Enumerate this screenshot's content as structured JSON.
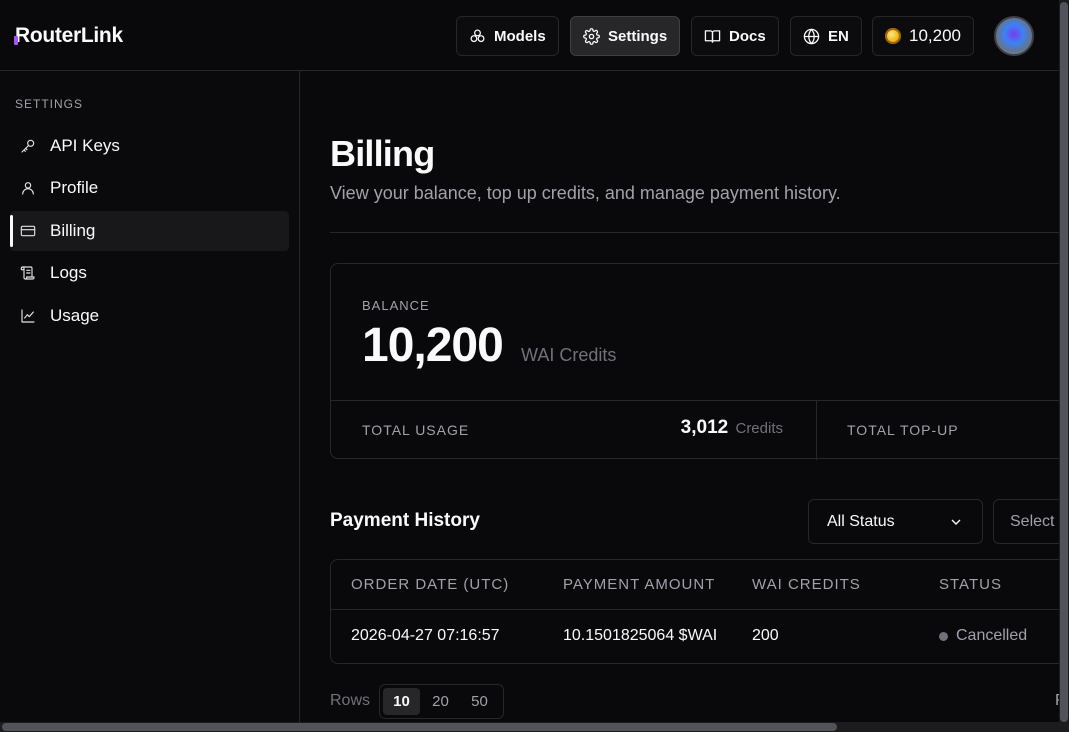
{
  "header": {
    "logo": "RouterLink",
    "nav": [
      {
        "label": "Models",
        "icon": "models-icon"
      },
      {
        "label": "Settings",
        "icon": "gear-icon"
      },
      {
        "label": "Docs",
        "icon": "book-icon"
      },
      {
        "label": "EN",
        "icon": "globe-icon"
      }
    ],
    "credits": "10,200"
  },
  "sidebar": {
    "title": "SETTINGS",
    "items": [
      {
        "label": "API Keys",
        "icon": "key-icon"
      },
      {
        "label": "Profile",
        "icon": "user-icon"
      },
      {
        "label": "Billing",
        "icon": "card-icon"
      },
      {
        "label": "Logs",
        "icon": "scroll-icon"
      },
      {
        "label": "Usage",
        "icon": "chart-icon"
      }
    ],
    "active": "Billing"
  },
  "main": {
    "title": "Billing",
    "subtitle": "View your balance, top up credits, and manage payment history.",
    "balance": {
      "label": "BALANCE",
      "value": "10,200",
      "unit": "WAI Credits",
      "usage_label": "TOTAL USAGE",
      "usage_value": "3,012",
      "usage_unit": "Credits",
      "topup_label": "TOTAL TOP-UP"
    },
    "history": {
      "title": "Payment History",
      "status_filter": "All Status",
      "second_filter": "Select",
      "columns": [
        "ORDER DATE (UTC)",
        "PAYMENT AMOUNT",
        "WAI CREDITS",
        "STATUS"
      ],
      "rows": [
        {
          "date": "2026-04-27 07:16:57",
          "amount": "10.1501825064 $WAI",
          "credits": "200",
          "status": "Cancelled"
        }
      ]
    },
    "pagination": {
      "rows_label": "Rows",
      "options": [
        "10",
        "20",
        "50"
      ],
      "selected": "10",
      "trailing": "P"
    }
  },
  "colors": {
    "background": "#09090b",
    "border": "#27272a",
    "muted": "#a1a1aa",
    "logo_accent": "#a855f7",
    "status_cancelled": "#71717a"
  }
}
